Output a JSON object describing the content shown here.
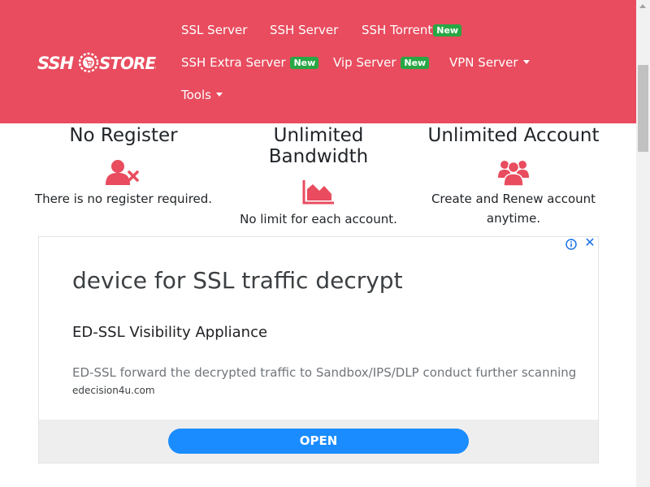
{
  "brand": {
    "logo_text": "SSHSTORES"
  },
  "nav": {
    "items": [
      {
        "label": "SSL Server"
      },
      {
        "label": "SSH Server"
      },
      {
        "label": "SSH Torrent",
        "badge": "New"
      },
      {
        "label": "SSH Extra Server",
        "badge": "New"
      },
      {
        "label": "Vip Server",
        "badge": "New"
      },
      {
        "label": "VPN Server",
        "dropdown": true
      },
      {
        "label": "Tools",
        "dropdown": true
      }
    ]
  },
  "features": [
    {
      "title": "No Register",
      "icon": "user-times-icon",
      "description": "There is no register required."
    },
    {
      "title": "Unlimited Bandwidth",
      "icon": "area-chart-icon",
      "description": "No limit for each account."
    },
    {
      "title": "Unlimited Account",
      "icon": "users-icon",
      "description": "Create and Renew account anytime."
    }
  ],
  "ad": {
    "headline": "device for SSL traffic decrypt",
    "subheadline": "ED-SSL Visibility Appliance",
    "description": "ED-SSL forward the decrypted traffic to Sandbox/IPS/DLP conduct further scanning",
    "domain": "edecision4u.com",
    "cta": "OPEN",
    "close_symbol": "✕"
  },
  "colors": {
    "navbar": "#e84c5e",
    "badge": "#28a745",
    "feature_icon": "#e84c5e",
    "cta": "#1a8cff"
  }
}
